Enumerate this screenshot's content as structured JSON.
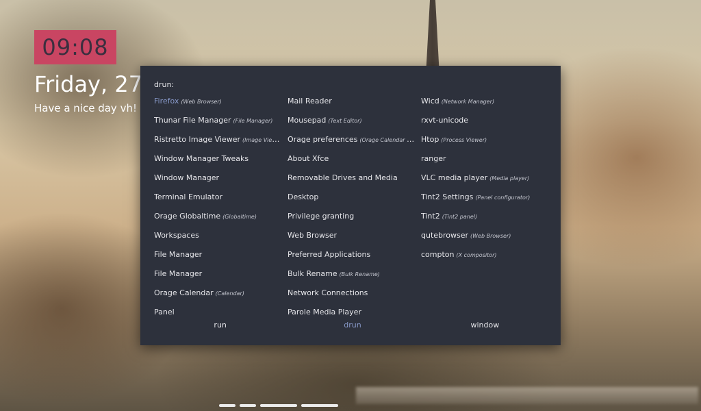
{
  "clock": {
    "time": "09:08"
  },
  "date": {
    "text": "Friday, 27"
  },
  "greeting": {
    "text": "Have a nice day vh! H"
  },
  "launcher": {
    "prompt": "drun:",
    "apps": [
      {
        "name": "Firefox",
        "desc": "(Web Browser)",
        "selected": true
      },
      {
        "name": "Thunar File Manager",
        "desc": "(File Manager)"
      },
      {
        "name": "Ristretto Image Viewer",
        "desc": "(Image Viewer)"
      },
      {
        "name": "Window Manager Tweaks",
        "desc": ""
      },
      {
        "name": "Window Manager",
        "desc": ""
      },
      {
        "name": "Terminal Emulator",
        "desc": ""
      },
      {
        "name": "Orage Globaltime",
        "desc": "(Globaltime)"
      },
      {
        "name": "Workspaces",
        "desc": ""
      },
      {
        "name": "File Manager",
        "desc": ""
      },
      {
        "name": "File Manager",
        "desc": ""
      },
      {
        "name": "Orage Calendar",
        "desc": "(Calendar)"
      },
      {
        "name": "Panel",
        "desc": ""
      },
      {
        "name": "Mail Reader",
        "desc": ""
      },
      {
        "name": "Mousepad",
        "desc": "(Text Editor)"
      },
      {
        "name": "Orage preferences",
        "desc": "(Orage Calendar Pref..."
      },
      {
        "name": "About Xfce",
        "desc": ""
      },
      {
        "name": "Removable Drives and Media",
        "desc": ""
      },
      {
        "name": "Desktop",
        "desc": ""
      },
      {
        "name": "Privilege granting",
        "desc": ""
      },
      {
        "name": "Web Browser",
        "desc": ""
      },
      {
        "name": "Preferred Applications",
        "desc": ""
      },
      {
        "name": "Bulk Rename",
        "desc": "(Bulk Rename)"
      },
      {
        "name": "Network Connections",
        "desc": ""
      },
      {
        "name": "Parole Media Player",
        "desc": ""
      },
      {
        "name": "Wicd",
        "desc": "(Network Manager)"
      },
      {
        "name": "rxvt-unicode",
        "desc": ""
      },
      {
        "name": "Htop",
        "desc": "(Process Viewer)"
      },
      {
        "name": "ranger",
        "desc": ""
      },
      {
        "name": "VLC media player",
        "desc": "(Media player)"
      },
      {
        "name": "Tint2 Settings",
        "desc": "(Panel configurator)"
      },
      {
        "name": "Tint2",
        "desc": "(Tint2 panel)"
      },
      {
        "name": "qutebrowser",
        "desc": "(Web Browser)"
      },
      {
        "name": "compton",
        "desc": "(X compositor)"
      }
    ],
    "modes": [
      {
        "label": "run",
        "active": false
      },
      {
        "label": "drun",
        "active": true
      },
      {
        "label": "window",
        "active": false
      }
    ]
  },
  "colors": {
    "clock_bg": "#c94562",
    "launcher_bg": "#2d313c",
    "accent": "#8899c9"
  }
}
